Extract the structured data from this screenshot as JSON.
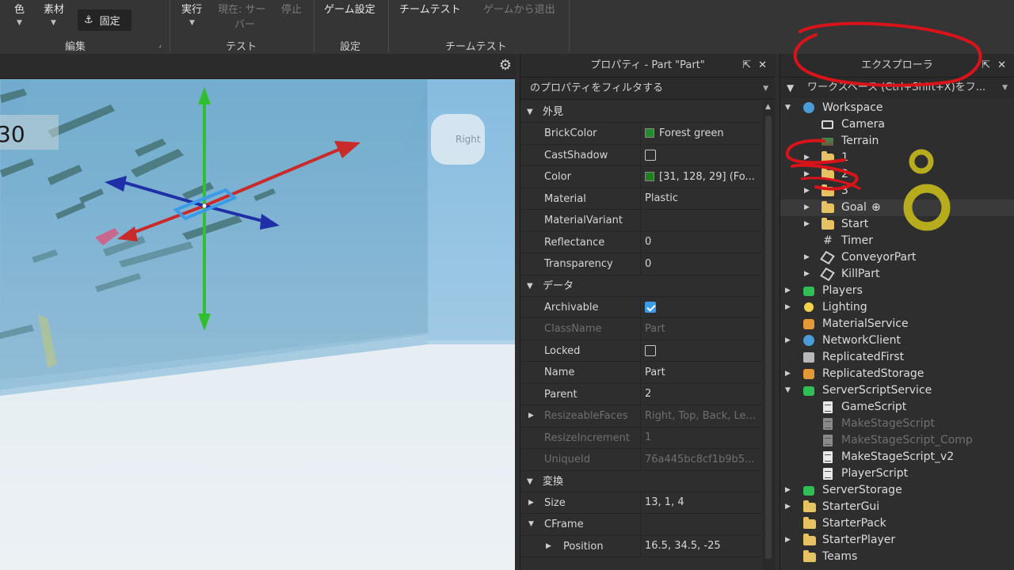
{
  "ribbon": {
    "color_label": "色",
    "material_label": "素材",
    "lock_label": "固定",
    "edit_group": "編集",
    "run_label": "実行",
    "current_label": "現在: サー\nバー",
    "current_line1": "現在: サー",
    "current_line2": "バー",
    "stop_label": "停止",
    "test_group": "テスト",
    "game_settings_label": "ゲーム設定",
    "settings_group": "設定",
    "team_test_label": "チームテスト",
    "exit_game_label": "ゲームから退出",
    "team_test_group": "チームテスト"
  },
  "viewport": {
    "counter_text": "30",
    "viewcube_label": "Right"
  },
  "properties": {
    "title": "プロパティ - Part \"Part\"",
    "filter_placeholder": "のプロパティをフィルタする",
    "sections": {
      "appearance": "外見",
      "data": "データ",
      "transform": "変換"
    },
    "rows": {
      "brickcolor": {
        "name": "BrickColor",
        "value": "Forest green",
        "swatch": "#1f8e2b"
      },
      "castshadow": {
        "name": "CastShadow",
        "checked": false
      },
      "color": {
        "name": "Color",
        "value": "[31, 128, 29] (Fo...",
        "swatch": "#1f801d"
      },
      "material": {
        "name": "Material",
        "value": "Plastic"
      },
      "materialvariant": {
        "name": "MaterialVariant",
        "value": ""
      },
      "reflectance": {
        "name": "Reflectance",
        "value": "0"
      },
      "transparency": {
        "name": "Transparency",
        "value": "0"
      },
      "archivable": {
        "name": "Archivable",
        "checked": true
      },
      "classname": {
        "name": "ClassName",
        "value": "Part"
      },
      "locked": {
        "name": "Locked",
        "checked": false
      },
      "name": {
        "name": "Name",
        "value": "Part"
      },
      "parent": {
        "name": "Parent",
        "value": "2"
      },
      "resizeablefaces": {
        "name": "ResizeableFaces",
        "value": "Right, Top, Back, Le..."
      },
      "resizeincrement": {
        "name": "ResizeIncrement",
        "value": "1"
      },
      "uniqueid": {
        "name": "UniqueId",
        "value": "76a445bc8cf1b9b5..."
      },
      "size": {
        "name": "Size",
        "value": "13, 1, 4"
      },
      "cframe": {
        "name": "CFrame",
        "value": ""
      },
      "position": {
        "name": "Position",
        "value": "16.5, 34.5, -25"
      }
    }
  },
  "explorer": {
    "title": "エクスプローラ",
    "filter_placeholder": "ワークスペース (Ctrl+Shift+X)をフ...",
    "nodes": {
      "workspace": "Workspace",
      "camera": "Camera",
      "terrain": "Terrain",
      "f1": "1",
      "f2": "2",
      "f3": "3",
      "goal": "Goal",
      "start": "Start",
      "timer": "Timer",
      "conveyor": "ConveyorPart",
      "kill": "KillPart",
      "players": "Players",
      "lighting": "Lighting",
      "materialservice": "MaterialService",
      "networkclient": "NetworkClient",
      "replicatedfirst": "ReplicatedFirst",
      "replicatedstorage": "ReplicatedStorage",
      "serverscriptservice": "ServerScriptService",
      "gamescript": "GameScript",
      "makestagescript": "MakeStageScript",
      "makestagescript_comp": "MakeStageScript_Comp",
      "makestagescript_v2": "MakeStageScript_v2",
      "playerscript": "PlayerScript",
      "serverstorage": "ServerStorage",
      "startergui": "StarterGui",
      "starterpack": "StarterPack",
      "starterplayer": "StarterPlayer",
      "teams": "Teams"
    }
  },
  "icons": {
    "gear": "gear-icon",
    "close": "close-icon",
    "undock": "undock-icon",
    "filter": "filter-icon",
    "anchor": "anchor-icon"
  },
  "colors": {
    "annotation_red": "#d8141a",
    "annotation_olive": "#b7ac1e",
    "selection_blue": "#3a9be8",
    "axis_green": "#2fbf2f",
    "axis_red": "#c92a2a",
    "axis_blue": "#1f2fa8"
  }
}
